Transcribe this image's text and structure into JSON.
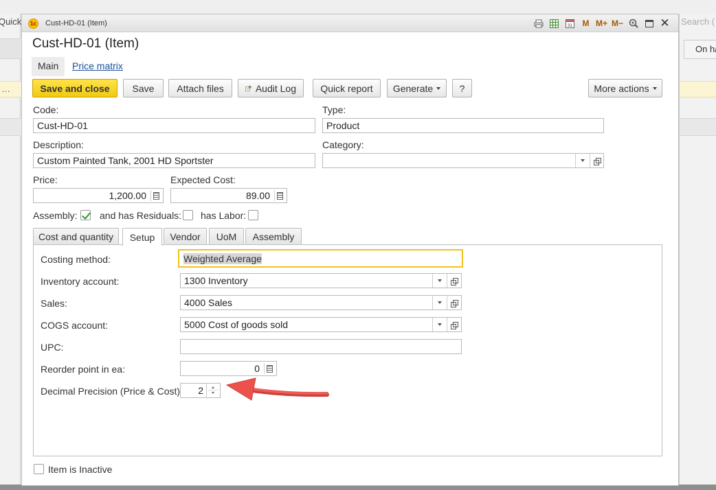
{
  "background": {
    "left_label": "Quick",
    "left_row_text": "…",
    "right_search": "Search (",
    "right_header": "On ha"
  },
  "window": {
    "title": "Cust-HD-01 (Item)",
    "app_icon_text": "1c",
    "toolbar_icons": [
      "print-icon",
      "spreadsheet-icon",
      "calendar-icon",
      "memory-m-icon",
      "memory-plus-icon",
      "memory-minus-icon",
      "zoom-icon",
      "maximize-icon",
      "close-icon"
    ],
    "toolbar_glyphs": {
      "m": "M",
      "mplus": "M+",
      "mminus": "M−",
      "close": "✕"
    }
  },
  "form": {
    "title": "Cust-HD-01 (Item)",
    "sections": {
      "main": "Main",
      "price_matrix": "Price matrix"
    },
    "buttons": {
      "save_close": "Save and close",
      "save": "Save",
      "attach": "Attach files",
      "audit": "Audit Log",
      "quick_report": "Quick report",
      "generate": "Generate",
      "help": "?",
      "more": "More actions"
    },
    "code": {
      "label": "Code:",
      "value": "Cust-HD-01"
    },
    "type": {
      "label": "Type:",
      "value": "Product"
    },
    "description": {
      "label": "Description:",
      "value": "Custom Painted Tank, 2001 HD Sportster"
    },
    "category": {
      "label": "Category:",
      "value": ""
    },
    "price": {
      "label": "Price:",
      "value": "1,200.00"
    },
    "expected_cost": {
      "label": "Expected Cost:",
      "value": "89.00"
    },
    "assembly": {
      "label": "Assembly:",
      "checked": true
    },
    "residuals": {
      "label": "and has Residuals:",
      "checked": false
    },
    "labor": {
      "label": "has Labor:",
      "checked": false
    },
    "tabs": [
      "Cost and quantity",
      "Setup",
      "Vendor",
      "UoM",
      "Assembly"
    ],
    "active_tab": "Setup",
    "setup": {
      "costing_method": {
        "label": "Costing method:",
        "value": "Weighted Average"
      },
      "inventory_account": {
        "label": "Inventory account:",
        "value": "1300 Inventory"
      },
      "sales": {
        "label": "Sales:",
        "value": "4000 Sales"
      },
      "cogs_account": {
        "label": "COGS account:",
        "value": "5000 Cost of goods sold"
      },
      "upc": {
        "label": "UPC:",
        "value": ""
      },
      "reorder_point": {
        "label": "Reorder point in ea:",
        "value": "0"
      },
      "decimal_precision": {
        "label": "Decimal Precision (Price & Cost):",
        "value": "2"
      }
    },
    "inactive": {
      "label": "Item is Inactive",
      "checked": false
    }
  },
  "colors": {
    "primary_button": "#f1c913",
    "link": "#1a4f9a",
    "focus_border": "#f1c21b",
    "annotation_arrow": "#e8514a",
    "check": "#2c9a2c"
  }
}
